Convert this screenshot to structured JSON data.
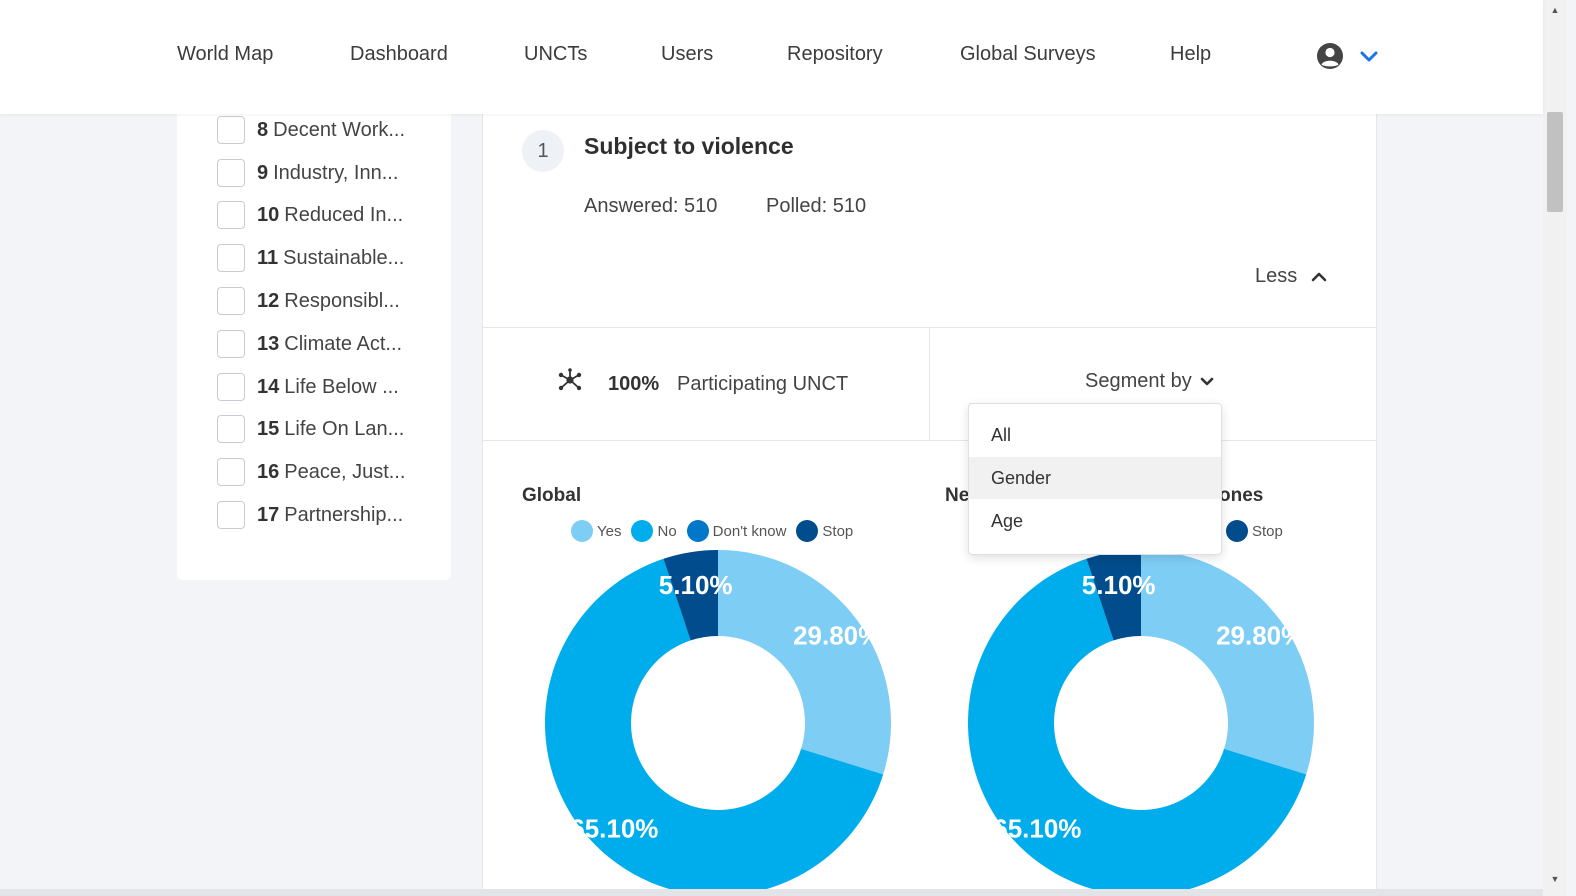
{
  "nav": {
    "items": [
      "World Map",
      "Dashboard",
      "UNCTs",
      "Users",
      "Repository",
      "Global Surveys",
      "Help"
    ],
    "user_icon": "user-circle-icon",
    "menu_icon": "chevron-down-icon",
    "accent": "#1a73e8"
  },
  "sidebar": {
    "goals": [
      {
        "num": "8",
        "label": "Decent Work..."
      },
      {
        "num": "9",
        "label": "Industry, Inn..."
      },
      {
        "num": "10",
        "label": "Reduced In..."
      },
      {
        "num": "11",
        "label": "Sustainable..."
      },
      {
        "num": "12",
        "label": "Responsibl..."
      },
      {
        "num": "13",
        "label": "Climate Act..."
      },
      {
        "num": "14",
        "label": "Life Below ..."
      },
      {
        "num": "15",
        "label": "Life On Lan..."
      },
      {
        "num": "16",
        "label": "Peace, Just..."
      },
      {
        "num": "17",
        "label": "Partnership..."
      }
    ]
  },
  "question": {
    "number": "1",
    "title": "Subject to violence",
    "answered": "Answered: 510",
    "polled": "Polled: 510",
    "less_label": "Less"
  },
  "participation": {
    "icon": "network-icon",
    "percent": "100%",
    "label": "Participating UNCT"
  },
  "segment": {
    "label": "Segment by",
    "options": [
      "All",
      "Gender",
      "Age"
    ],
    "highlighted": "Gender"
  },
  "colors": {
    "yes": "#7ecdf5",
    "no": "#00adec",
    "dont_know": "#0077c8",
    "stop": "#004c8c"
  },
  "chart_data": [
    {
      "type": "pie",
      "title": "Global",
      "legend": [
        "Yes",
        "No",
        "Don't know",
        "Stop"
      ],
      "values": [
        29.8,
        65.1,
        0,
        5.1
      ],
      "labels": [
        "29.80%",
        "65.10%",
        "",
        "5.10%"
      ]
    },
    {
      "type": "pie",
      "title_prefix": "Ne",
      "title_suffix": "ones",
      "legend": [
        "Stop"
      ],
      "values": [
        29.8,
        65.1,
        0,
        5.1
      ],
      "labels": [
        "29.80%",
        "65.10%",
        "",
        "5.10%"
      ]
    }
  ]
}
